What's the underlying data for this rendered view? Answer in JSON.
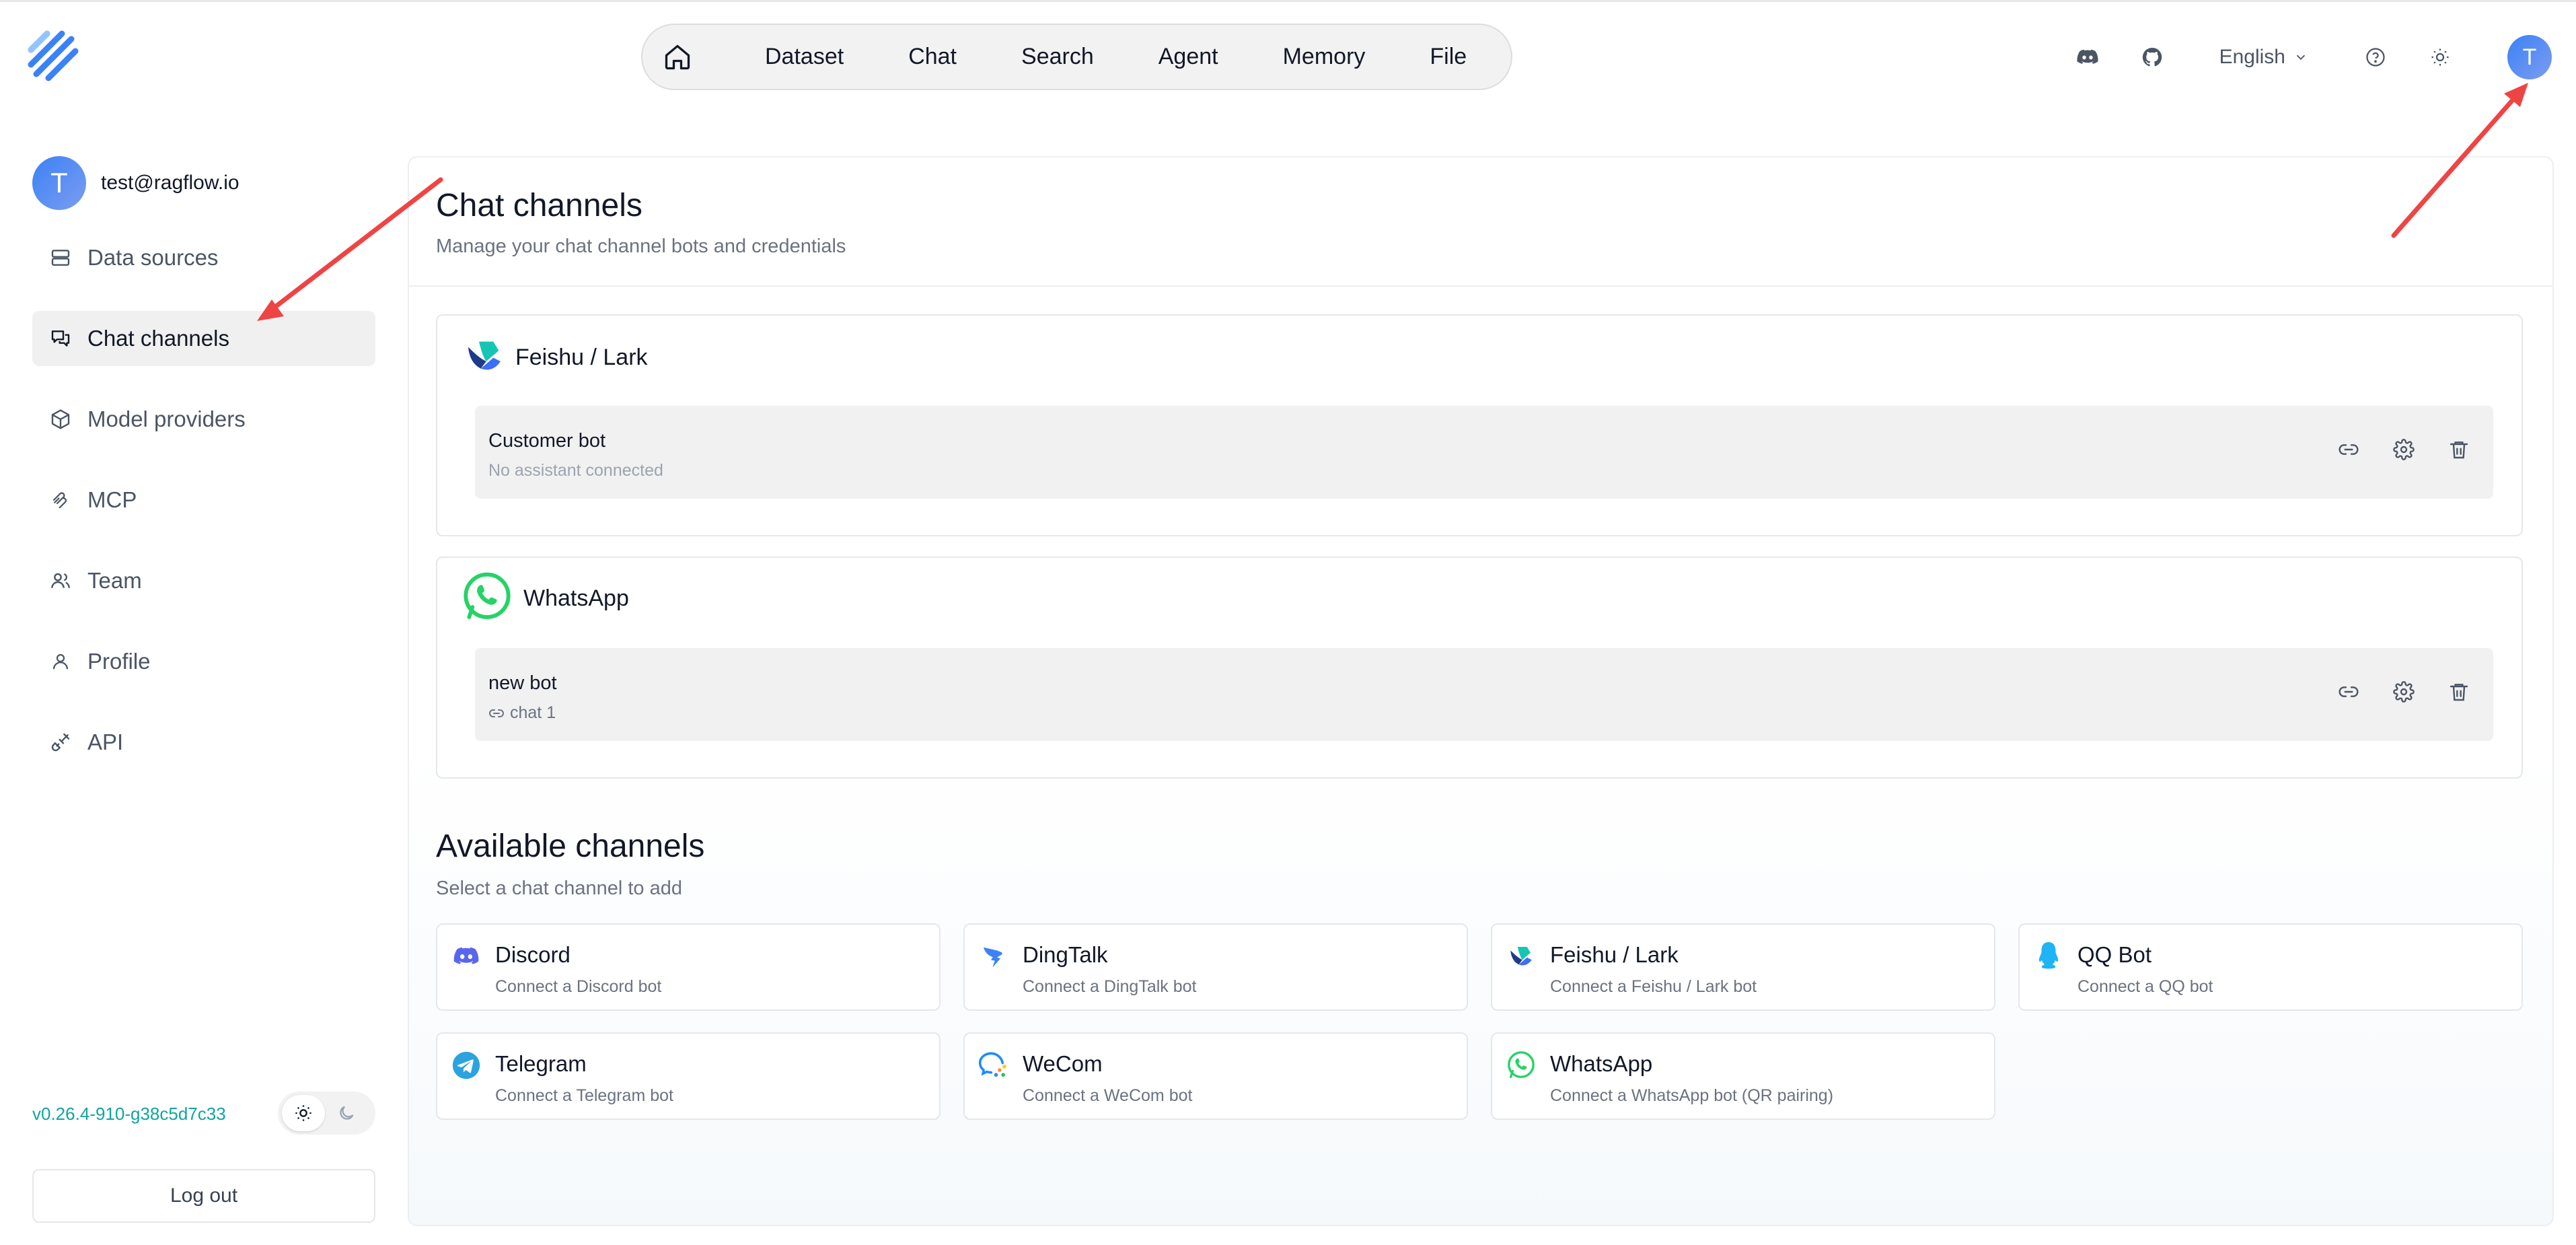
{
  "header": {
    "nav": [
      "Dataset",
      "Chat",
      "Search",
      "Agent",
      "Memory",
      "File"
    ],
    "language": "English",
    "avatar_letter": "T"
  },
  "sidebar": {
    "avatar_letter": "T",
    "user_email": "test@ragflow.io",
    "items": [
      {
        "label": "Data sources",
        "icon": "database-icon"
      },
      {
        "label": "Chat channels",
        "icon": "chat-channels-icon",
        "active": true
      },
      {
        "label": "Model providers",
        "icon": "cube-icon"
      },
      {
        "label": "MCP",
        "icon": "mcp-icon"
      },
      {
        "label": "Team",
        "icon": "team-icon"
      },
      {
        "label": "Profile",
        "icon": "user-icon"
      },
      {
        "label": "API",
        "icon": "plug-icon"
      }
    ],
    "version": "v0.26.4-910-g38c5d7c33",
    "logout": "Log out"
  },
  "main": {
    "title": "Chat channels",
    "subtitle": "Manage your chat channel bots and credentials",
    "channels": [
      {
        "name": "Feishu / Lark",
        "bot": {
          "name": "Customer bot",
          "status": "No assistant connected"
        }
      },
      {
        "name": "WhatsApp",
        "bot": {
          "name": "new bot",
          "status": "chat 1"
        }
      }
    ],
    "available_title": "Available channels",
    "available_subtitle": "Select a chat channel to add",
    "available": [
      {
        "name": "Discord",
        "desc": "Connect a Discord bot"
      },
      {
        "name": "DingTalk",
        "desc": "Connect a DingTalk bot"
      },
      {
        "name": "Feishu / Lark",
        "desc": "Connect a Feishu / Lark bot"
      },
      {
        "name": "QQ Bot",
        "desc": "Connect a QQ bot"
      },
      {
        "name": "Telegram",
        "desc": "Connect a Telegram bot"
      },
      {
        "name": "WeCom",
        "desc": "Connect a WeCom bot"
      },
      {
        "name": "WhatsApp",
        "desc": "Connect a WhatsApp bot (QR pairing)"
      }
    ]
  },
  "colors": {
    "accent_blue": "#3b82f6",
    "arrow_red": "#ef4444",
    "version_teal": "#10a5a0",
    "whatsapp_green": "#25d366"
  }
}
